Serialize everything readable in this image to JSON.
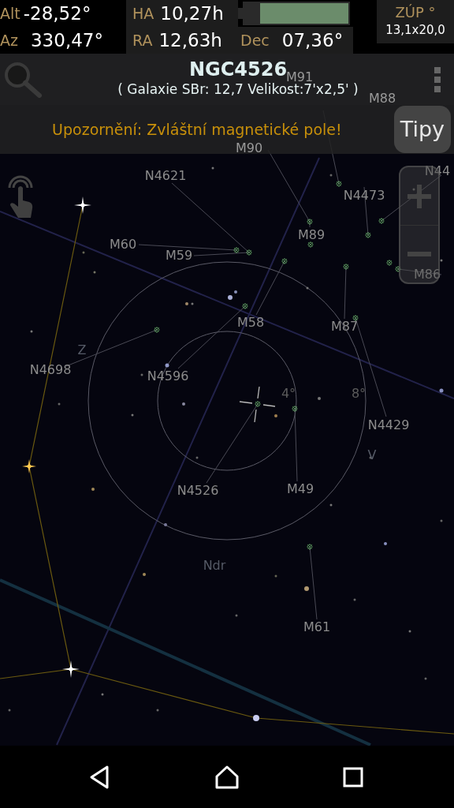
{
  "readouts": [
    {
      "label": "Alt",
      "value": "-28,52°"
    },
    {
      "label": "Az",
      "value": "330,47°"
    },
    {
      "label": "HA",
      "value": "10,27h"
    },
    {
      "label": "RA",
      "value": "12,63h"
    },
    {
      "label": "Dec",
      "value": "07,36°"
    }
  ],
  "field_of_view": {
    "label": "ZÚP °",
    "value": "13,1x20,0"
  },
  "object": {
    "name": "NGC4526",
    "details": "( Galaxie SBr: 12,7 Velikost:7'x2,5' )"
  },
  "warning": {
    "text": "Upozornění: Zvláštní magnetické pole!",
    "button": "Tipy"
  },
  "map_labels": [
    {
      "text": "M91",
      "kind": "object"
    },
    {
      "text": "M88",
      "kind": "object"
    },
    {
      "text": "M90",
      "kind": "object"
    },
    {
      "text": "N4621",
      "kind": "object"
    },
    {
      "text": "N44",
      "kind": "object"
    },
    {
      "text": "N4473",
      "kind": "object"
    },
    {
      "text": "M60",
      "kind": "object"
    },
    {
      "text": "M89",
      "kind": "object"
    },
    {
      "text": "M59",
      "kind": "object"
    },
    {
      "text": "M86",
      "kind": "object"
    },
    {
      "text": "M58",
      "kind": "object"
    },
    {
      "text": "M87",
      "kind": "object"
    },
    {
      "text": "Z",
      "kind": "constellation"
    },
    {
      "text": "N4698",
      "kind": "object"
    },
    {
      "text": "N4596",
      "kind": "object"
    },
    {
      "text": "4°",
      "kind": "scale"
    },
    {
      "text": "8°",
      "kind": "scale"
    },
    {
      "text": "N4429",
      "kind": "object"
    },
    {
      "text": "V",
      "kind": "constellation"
    },
    {
      "text": "N4526",
      "kind": "object"
    },
    {
      "text": "M49",
      "kind": "object"
    },
    {
      "text": "Ndr",
      "kind": "constellation"
    },
    {
      "text": "M61",
      "kind": "object"
    }
  ]
}
